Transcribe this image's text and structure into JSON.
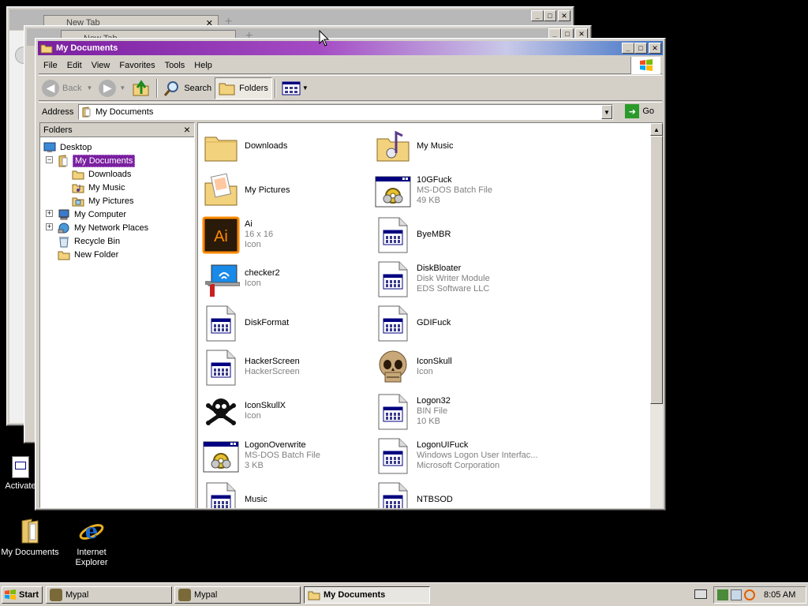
{
  "background_windows": [
    {
      "tab_title": "New Tab",
      "new_tab_symbol": "+"
    },
    {
      "tab_title": "New Tab",
      "new_tab_symbol": "+"
    }
  ],
  "window": {
    "title": "My Documents",
    "menu": [
      "File",
      "Edit",
      "View",
      "Favorites",
      "Tools",
      "Help"
    ],
    "toolbar": {
      "back": "Back",
      "search": "Search",
      "folders": "Folders"
    },
    "address": {
      "label": "Address",
      "value": "My Documents",
      "go": "Go"
    },
    "folders_panel": {
      "title": "Folders",
      "close": "×",
      "tree": [
        {
          "label": "Desktop",
          "icon": "desktop-icon"
        },
        {
          "label": "My Documents",
          "icon": "my-documents-icon",
          "selected": true,
          "expander": "−"
        },
        {
          "label": "Downloads",
          "icon": "folder-icon"
        },
        {
          "label": "My Music",
          "icon": "music-folder-icon"
        },
        {
          "label": "My Pictures",
          "icon": "pictures-folder-icon"
        },
        {
          "label": "My Computer",
          "icon": "computer-icon",
          "expander": "+"
        },
        {
          "label": "My Network Places",
          "icon": "network-icon",
          "expander": "+"
        },
        {
          "label": "Recycle Bin",
          "icon": "recycle-bin-icon"
        },
        {
          "label": "New Folder",
          "icon": "folder-icon"
        }
      ]
    },
    "files": [
      {
        "name": "Downloads",
        "lines": [],
        "icon": "folder-icon"
      },
      {
        "name": "My Music",
        "lines": [],
        "icon": "music-folder-icon"
      },
      {
        "name": "My Pictures",
        "lines": [],
        "icon": "pictures-folder-icon"
      },
      {
        "name": "10GFuck",
        "lines": [
          "MS-DOS Batch File",
          "49 KB"
        ],
        "icon": "batch-file-icon"
      },
      {
        "name": "Ai",
        "lines": [
          "16 x 16",
          "Icon"
        ],
        "icon": "adobe-illustrator-icon"
      },
      {
        "name": "ByeMBR",
        "lines": [],
        "icon": "application-icon"
      },
      {
        "name": "checker2",
        "lines": [
          "Icon"
        ],
        "icon": "network-tools-icon"
      },
      {
        "name": "DiskBloater",
        "lines": [
          "Disk Writer Module",
          "EDS Software LLC"
        ],
        "icon": "application-icon"
      },
      {
        "name": "DiskFormat",
        "lines": [],
        "icon": "application-icon"
      },
      {
        "name": "GDIFuck",
        "lines": [],
        "icon": "application-icon"
      },
      {
        "name": "HackerScreen",
        "lines": [
          "HackerScreen"
        ],
        "icon": "application-icon"
      },
      {
        "name": "IconSkull",
        "lines": [
          "Icon"
        ],
        "icon": "skull-icon"
      },
      {
        "name": "IconSkullX",
        "lines": [
          "Icon"
        ],
        "icon": "skull-crossbones-icon"
      },
      {
        "name": "Logon32",
        "lines": [
          "BIN File",
          "10 KB"
        ],
        "icon": "application-icon"
      },
      {
        "name": "LogonOverwrite",
        "lines": [
          "MS-DOS Batch File",
          "3 KB"
        ],
        "icon": "batch-file-icon"
      },
      {
        "name": "LogonUIFuck",
        "lines": [
          "Windows Logon User Interfac...",
          "Microsoft Corporation"
        ],
        "icon": "application-icon"
      },
      {
        "name": "Music",
        "lines": [],
        "icon": "application-icon"
      },
      {
        "name": "NTBSOD",
        "lines": [],
        "icon": "application-icon"
      }
    ]
  },
  "desktop_icons": [
    {
      "label": "Activate",
      "icon": "application-icon"
    },
    {
      "label": "My Documents",
      "icon": "my-documents-icon"
    },
    {
      "label": "Internet Explorer",
      "icon": "internet-explorer-icon"
    }
  ],
  "taskbar": {
    "start": "Start",
    "tasks": [
      {
        "label": "Mypal",
        "active": false
      },
      {
        "label": "Mypal",
        "active": false
      },
      {
        "label": "My Documents",
        "active": true
      }
    ],
    "clock": "8:05 AM"
  },
  "colors": {
    "title_active_start": "#7a1fa0",
    "title_active_end": "#3a6fc4",
    "selection": "#7a1fa0",
    "chrome": "#d4d0c8"
  }
}
